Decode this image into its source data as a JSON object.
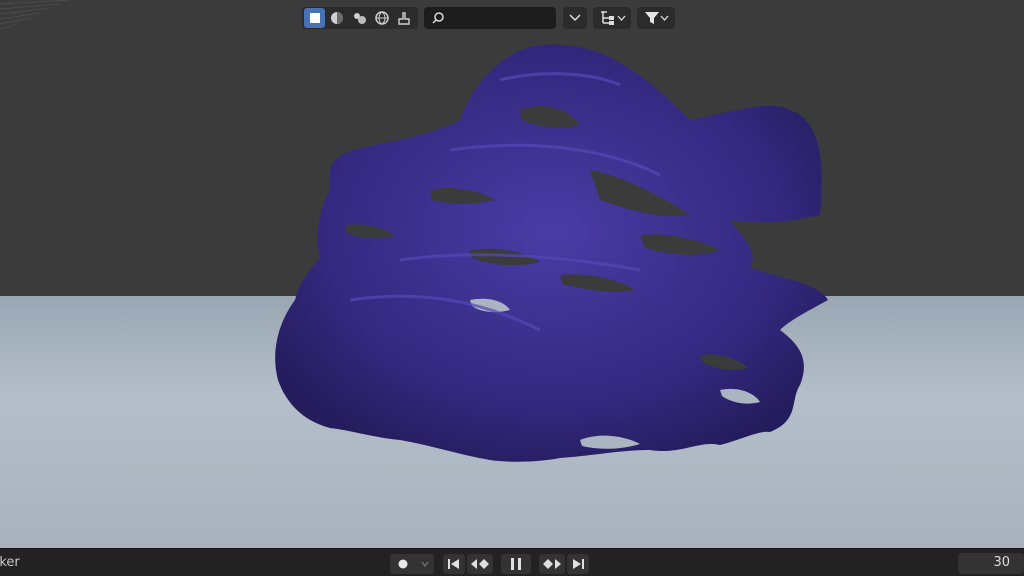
{
  "header": {
    "shading_modes": [
      {
        "icon": "wireframe-square-icon",
        "active": true
      },
      {
        "icon": "solid-sphere-icon",
        "active": false
      },
      {
        "icon": "material-preview-icon",
        "active": false
      },
      {
        "icon": "rendered-globe-icon",
        "active": false
      },
      {
        "icon": "brush-icon",
        "active": false
      }
    ],
    "search": {
      "value": "",
      "placeholder": ""
    },
    "icons": [
      "search-icon",
      "chevron-down-icon",
      "hierarchy-icon",
      "filter-funnel-icon"
    ]
  },
  "timeline": {
    "marker_label": "rker",
    "current_frame": "30",
    "controls": [
      "record-dot-icon",
      "chevron-down-icon",
      "jump-start-icon",
      "prev-keyframe-icon",
      "pause-icon",
      "next-keyframe-icon",
      "jump-end-icon"
    ]
  },
  "colors": {
    "smoke_mesh": "#3a2e8c",
    "ground": "#a9b4c1",
    "background": "#3b3b3b",
    "active_button": "#4772b3"
  }
}
